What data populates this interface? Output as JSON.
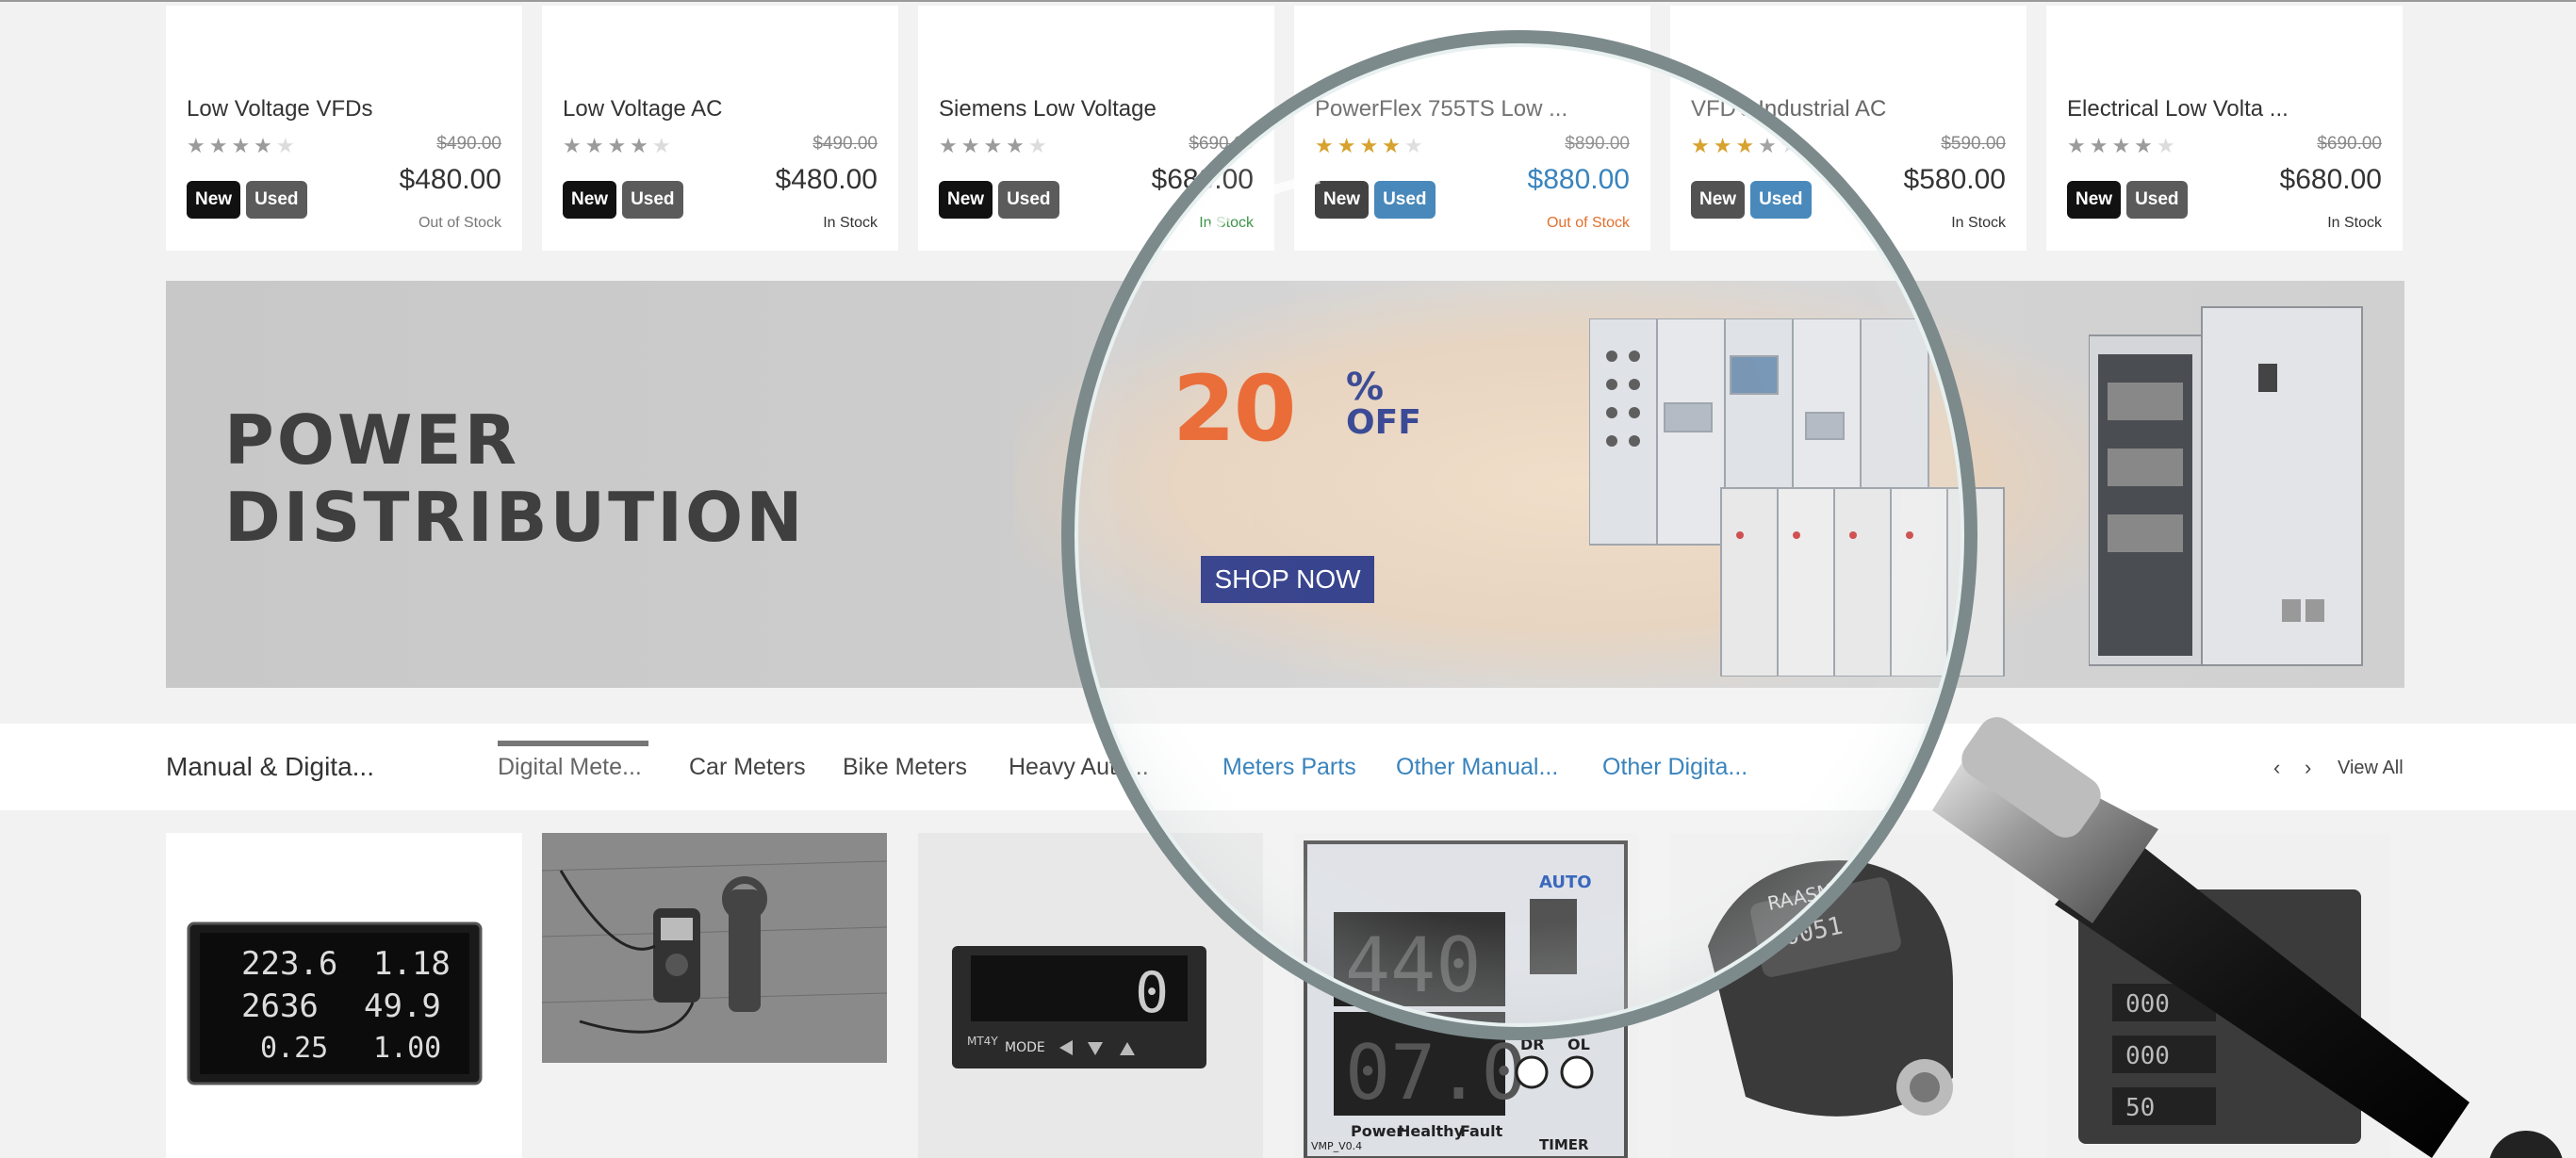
{
  "products_top": [
    {
      "name": "Low Voltage VFDs",
      "old_price": "$490.00",
      "price": "$480.00",
      "stock": "Out of Stock",
      "stars": 4,
      "badges": [
        "New",
        "Used"
      ]
    },
    {
      "name": "Low Voltage AC",
      "old_price": "$490.00",
      "price": "$480.00",
      "stock": "In Stock",
      "stars": 4,
      "badges": [
        "New",
        "Used"
      ]
    },
    {
      "name": "Siemens Low Voltage",
      "old_price": "$690.00",
      "price": "$680.00",
      "stock": "In Stock",
      "stars": 4,
      "badges": [
        "New",
        "Used"
      ]
    },
    {
      "name": "PowerFlex 755TS Low ...",
      "old_price": "$890.00",
      "price": "$880.00",
      "stock": "Out of Stock",
      "stars": 4,
      "badges": [
        "New",
        "Used"
      ]
    },
    {
      "name": "VFD's Industrial AC",
      "old_price": "$590.00",
      "price": "$580.00",
      "stock": "In Stock",
      "stars": 3,
      "badges": [
        "New",
        "Used"
      ]
    },
    {
      "name": "Electrical Low Volta ...",
      "old_price": "$690.00",
      "price": "$680.00",
      "stock": "In Stock",
      "stars": 4,
      "badges": [
        "New",
        "Used"
      ]
    }
  ],
  "banner": {
    "title_line1": "POWER",
    "title_line2": "DISTRIBUTION",
    "discount_number": "20",
    "discount_symbol": "%",
    "discount_word": "OFF",
    "cta": "SHOP NOW"
  },
  "category_section": {
    "title": "Manual & Digita...",
    "tabs": [
      {
        "label": "Digital Mete...",
        "active": true
      },
      {
        "label": "Car Meters",
        "active": false
      },
      {
        "label": "Bike Meters",
        "active": false
      },
      {
        "label": "Heavy Auto...",
        "active": false
      },
      {
        "label": "Meters Parts",
        "active": false
      },
      {
        "label": "Other Manual...",
        "active": false
      },
      {
        "label": "Other Digita...",
        "active": false
      }
    ],
    "prev_icon": "chevron-left-icon",
    "next_icon": "chevron-right-icon",
    "view_all": "View All"
  },
  "meter_readouts": {
    "panel_meter": [
      "223.6",
      "1.18",
      "2636",
      "49.9",
      "0.25",
      "1.00"
    ],
    "timer_top": "440",
    "timer_bottom": "07.0",
    "timer_labels": [
      "AUTO",
      "DR",
      "OL",
      "Power",
      "Healthy",
      "Fault",
      "TIMER",
      "VMP_V0.4"
    ],
    "fuel_meter_brand": "RAASM",
    "fuel_meter_display": "0051",
    "panel_controller_label": "MT4Y",
    "panel_controller_mode": "MODE",
    "panel_controller_digit": "0",
    "right_meter_values": [
      "000",
      "000",
      "50"
    ]
  },
  "colors": {
    "accent_blue": "#2a7ab8",
    "banner_orange": "#e8622a",
    "banner_navy": "#2b3786",
    "star_gold": "#d49a1d",
    "stock_green": "#2e8b3a",
    "stock_orange": "#e0661f"
  }
}
